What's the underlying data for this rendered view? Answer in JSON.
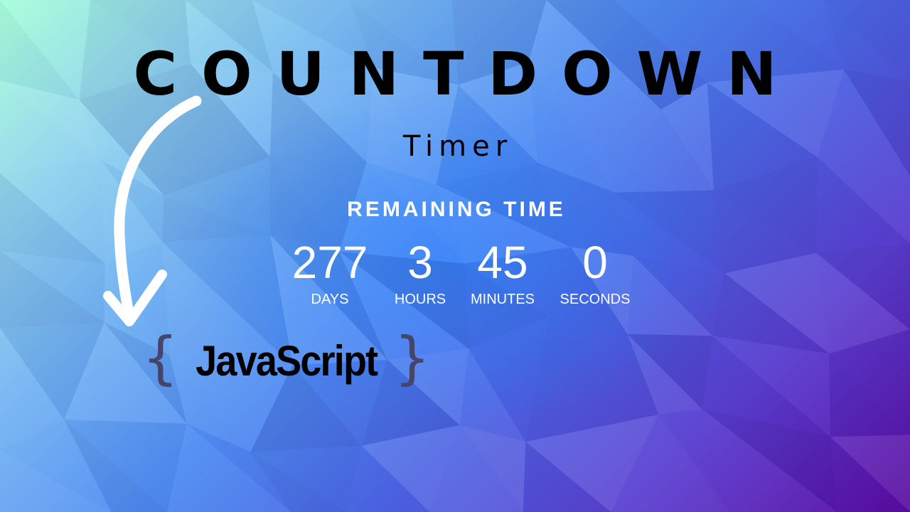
{
  "title": "COUNTDOWN",
  "subtitle": "Timer",
  "remaining_label": "REMAINING TIME",
  "countdown": {
    "days": {
      "value": "277",
      "label": "DAYS"
    },
    "hours": {
      "value": "3",
      "label": "HOURS"
    },
    "minutes": {
      "value": "45",
      "label": "MINUTES"
    },
    "seconds": {
      "value": "0",
      "label": "SECONDS"
    }
  },
  "logo": {
    "brace_open": "{",
    "word": "JavaScript",
    "brace_close": "}"
  },
  "colors": {
    "title": "#000000",
    "timer_text": "#ffffff",
    "brace": "#45456b",
    "arrow": "#ffffff"
  },
  "icons": {
    "arrow": "curved-arrow-icon"
  }
}
